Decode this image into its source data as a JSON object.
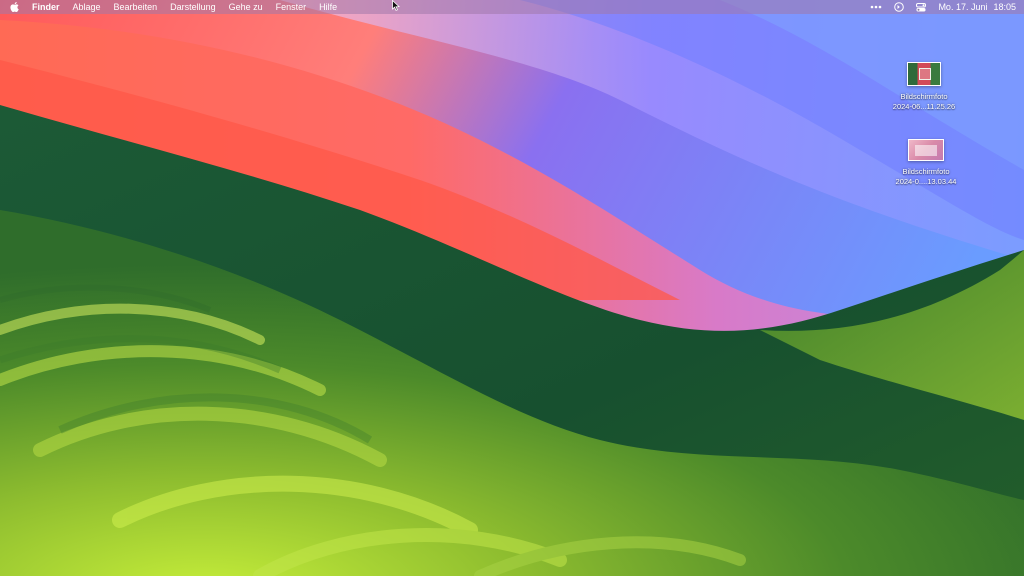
{
  "menubar": {
    "apple_icon": "apple-icon",
    "items": [
      {
        "label": "Finder",
        "bold": true
      },
      {
        "label": "Ablage"
      },
      {
        "label": "Bearbeiten"
      },
      {
        "label": "Darstellung"
      },
      {
        "label": "Gehe zu"
      },
      {
        "label": "Fenster"
      },
      {
        "label": "Hilfe"
      }
    ],
    "status_icons": [
      "more-dots-icon",
      "siri-icon",
      "control-center-icon"
    ],
    "clock": {
      "date": "Mo. 17. Juni",
      "time": "18:05"
    }
  },
  "desktop": {
    "icons": [
      {
        "name_line1": "Bildschirmfoto",
        "name_line2": "2024-06...11.25.26"
      },
      {
        "name_line1": "Bildschirmfoto",
        "name_line2": "2024-0....13.03.44"
      }
    ]
  }
}
